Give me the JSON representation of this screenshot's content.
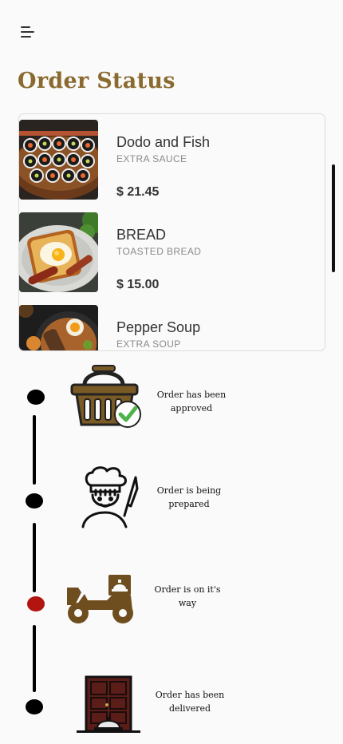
{
  "header": {
    "menu_icon": "menu-icon",
    "title": "Order Status"
  },
  "orders": [
    {
      "name": "Dodo and Fish",
      "note": "EXTRA SAUCE",
      "price": "$ 21.45",
      "image": "sushi-platter"
    },
    {
      "name": "BREAD",
      "note": "TOASTED BREAD",
      "price": "$ 15.00",
      "image": "toast-with-egg"
    },
    {
      "name": "Pepper Soup",
      "note": "EXTRA SOUP",
      "price": "",
      "image": "soup-bowl"
    }
  ],
  "tracking": {
    "steps": [
      {
        "label": "Order has been approved",
        "icon": "basket-check-icon",
        "state": "done"
      },
      {
        "label": "Order is being prepared",
        "icon": "chef-icon",
        "state": "done"
      },
      {
        "label": "Order is on it's way",
        "icon": "delivery-scooter-icon",
        "state": "current"
      },
      {
        "label": "Order has been delivered",
        "icon": "door-delivery-icon",
        "state": "pending"
      }
    ]
  },
  "colors": {
    "title": "#8a6a2f",
    "current_step": "#b2140f",
    "icon_brown": "#7a5a25"
  }
}
